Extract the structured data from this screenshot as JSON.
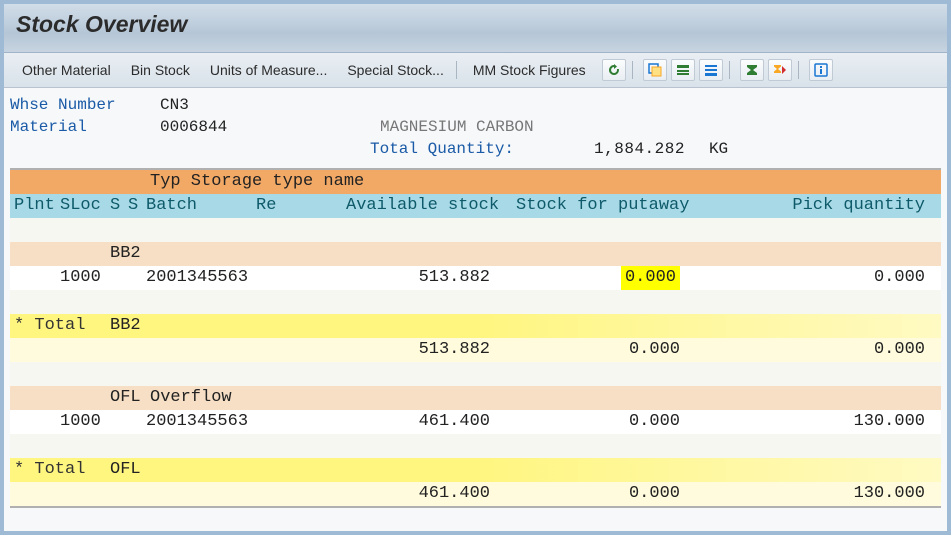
{
  "title": "Stock Overview",
  "toolbar": {
    "other_material": "Other Material",
    "bin_stock": "Bin Stock",
    "units_of_measure": "Units of Measure...",
    "special_stock": "Special Stock...",
    "mm_stock_figures": "MM Stock Figures"
  },
  "info": {
    "whse_number_label": "Whse Number",
    "whse_number_value": "CN3",
    "material_label": "Material",
    "material_value": "   0006844",
    "material_desc": "MAGNESIUM CARBON",
    "total_quantity_label": "Total Quantity:",
    "total_quantity_value": "1,884.282",
    "total_quantity_unit": "KG"
  },
  "columns": {
    "typ_storage_type": "Typ Storage type name",
    "plnt": "Plnt",
    "sloc": "SLoc",
    "s1": "S",
    "s2": "S",
    "batch": "Batch",
    "re": "Re",
    "available_stock": "Available stock",
    "stock_for_putaway": "Stock for putaway",
    "pick_quantity": "Pick quantity"
  },
  "groups": [
    {
      "typ": "BB2",
      "name": "",
      "rows": [
        {
          "plnt": "",
          "sloc": "1000",
          "batch": "2001345563",
          "available": "513.882",
          "putaway": "0.000",
          "putaway_highlight": true,
          "pick": "0.000"
        }
      ],
      "total": {
        "available": "513.882",
        "putaway": "0.000",
        "pick": "0.000"
      }
    },
    {
      "typ": "OFL",
      "name": "Overflow",
      "rows": [
        {
          "plnt": "",
          "sloc": "1000",
          "batch": "2001345563",
          "available": "461.400",
          "putaway": "0.000",
          "putaway_highlight": false,
          "pick": "130.000"
        }
      ],
      "total": {
        "available": "461.400",
        "putaway": "0.000",
        "pick": "130.000"
      }
    }
  ],
  "labels": {
    "total": "* Total"
  }
}
